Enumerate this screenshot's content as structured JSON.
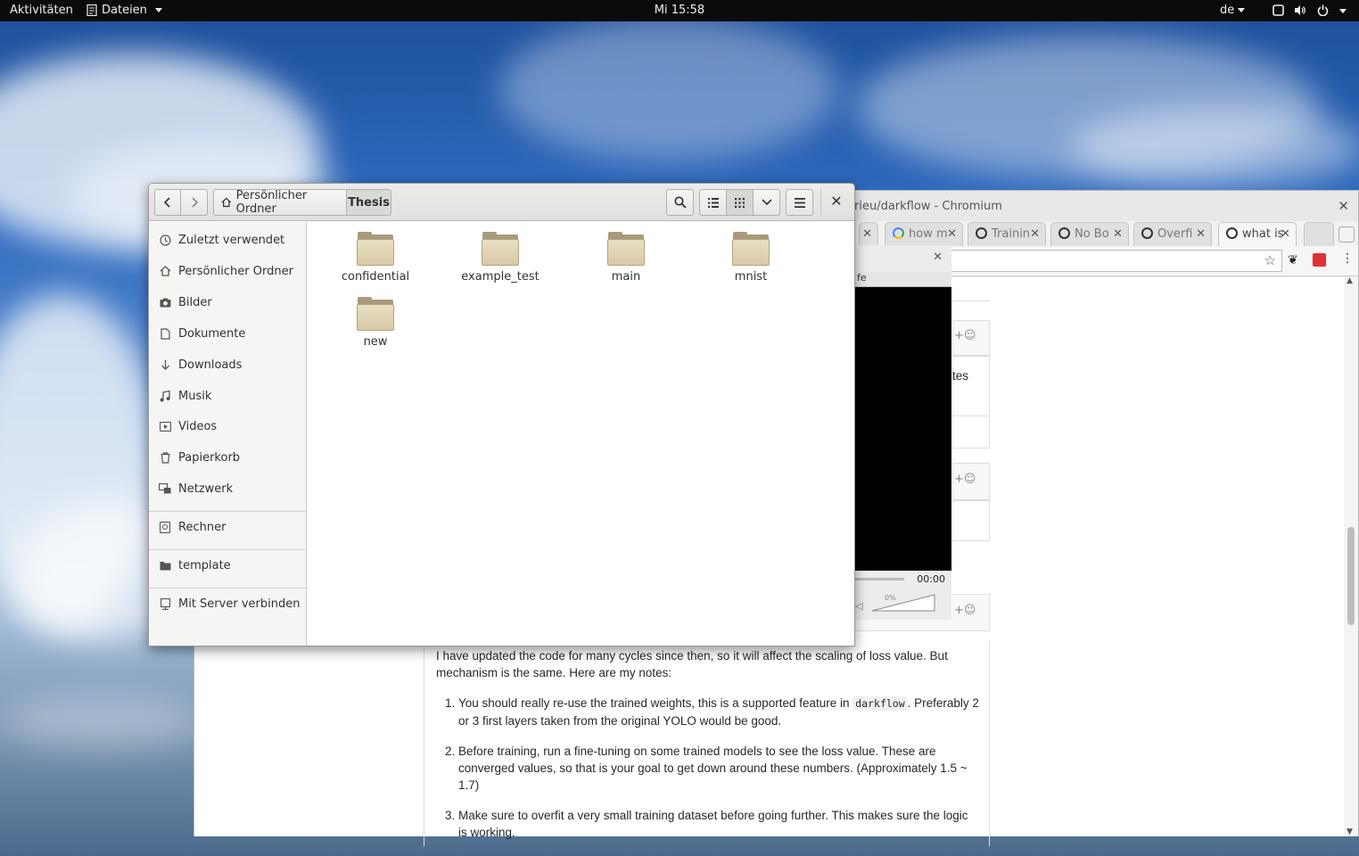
{
  "topbar": {
    "activities": "Aktivitäten",
    "app_menu": "Dateien",
    "clock": "Mi 15:58",
    "language": "de"
  },
  "chromium": {
    "title": "rieu/darkflow - Chromium",
    "tabs": [
      {
        "label": "how m",
        "icon": "google-icon"
      },
      {
        "label": "Trainin",
        "icon": "github-icon"
      },
      {
        "label": "No Bo",
        "icon": "github-icon"
      },
      {
        "label": "Overfi",
        "icon": "github-icon"
      },
      {
        "label": "what is",
        "icon": "github-icon"
      }
    ],
    "snippet_tes": "tes",
    "video_popup": {
      "title": "fe",
      "time": "00:00",
      "volume": "0%"
    },
    "article": {
      "intro": "I have updated the code for many cycles since then, so it will affect the scaling of loss value. But mechanism is the same. Here are my notes:",
      "item1_before": "You should really re-use the trained weights, this is a supported feature in ",
      "item1_code": "darkflow",
      "item1_after": ". Preferably 2 or 3 first layers taken from the original YOLO would be good.",
      "item2": "Before training, run a fine-tuning on some trained models to see the loss value. These are converged values, so that is your goal to get down around these numbers. (Approximately 1.5 ~ 1.7)",
      "item3": "Make sure to overfit a very small training dataset before going further. This makes sure the logic is working."
    }
  },
  "nautilus": {
    "breadcrumb": {
      "home": "Persönlicher Ordner",
      "current": "Thesis"
    },
    "sidebar": [
      {
        "label": "Zuletzt verwendet",
        "icon": "clock-icon"
      },
      {
        "label": "Persönlicher Ordner",
        "icon": "home-icon"
      },
      {
        "label": "Bilder",
        "icon": "camera-icon"
      },
      {
        "label": "Dokumente",
        "icon": "document-icon"
      },
      {
        "label": "Downloads",
        "icon": "download-icon"
      },
      {
        "label": "Musik",
        "icon": "music-icon"
      },
      {
        "label": "Videos",
        "icon": "video-icon"
      },
      {
        "label": "Papierkorb",
        "icon": "trash-icon"
      },
      {
        "label": "Netzwerk",
        "icon": "network-icon"
      },
      {
        "label": "Rechner",
        "icon": "computer-icon"
      },
      {
        "label": "template",
        "icon": "folder-icon"
      },
      {
        "label": "Mit Server verbinden",
        "icon": "server-icon"
      }
    ],
    "folders": [
      "confidential",
      "example_test",
      "main",
      "mnist",
      "new"
    ]
  }
}
